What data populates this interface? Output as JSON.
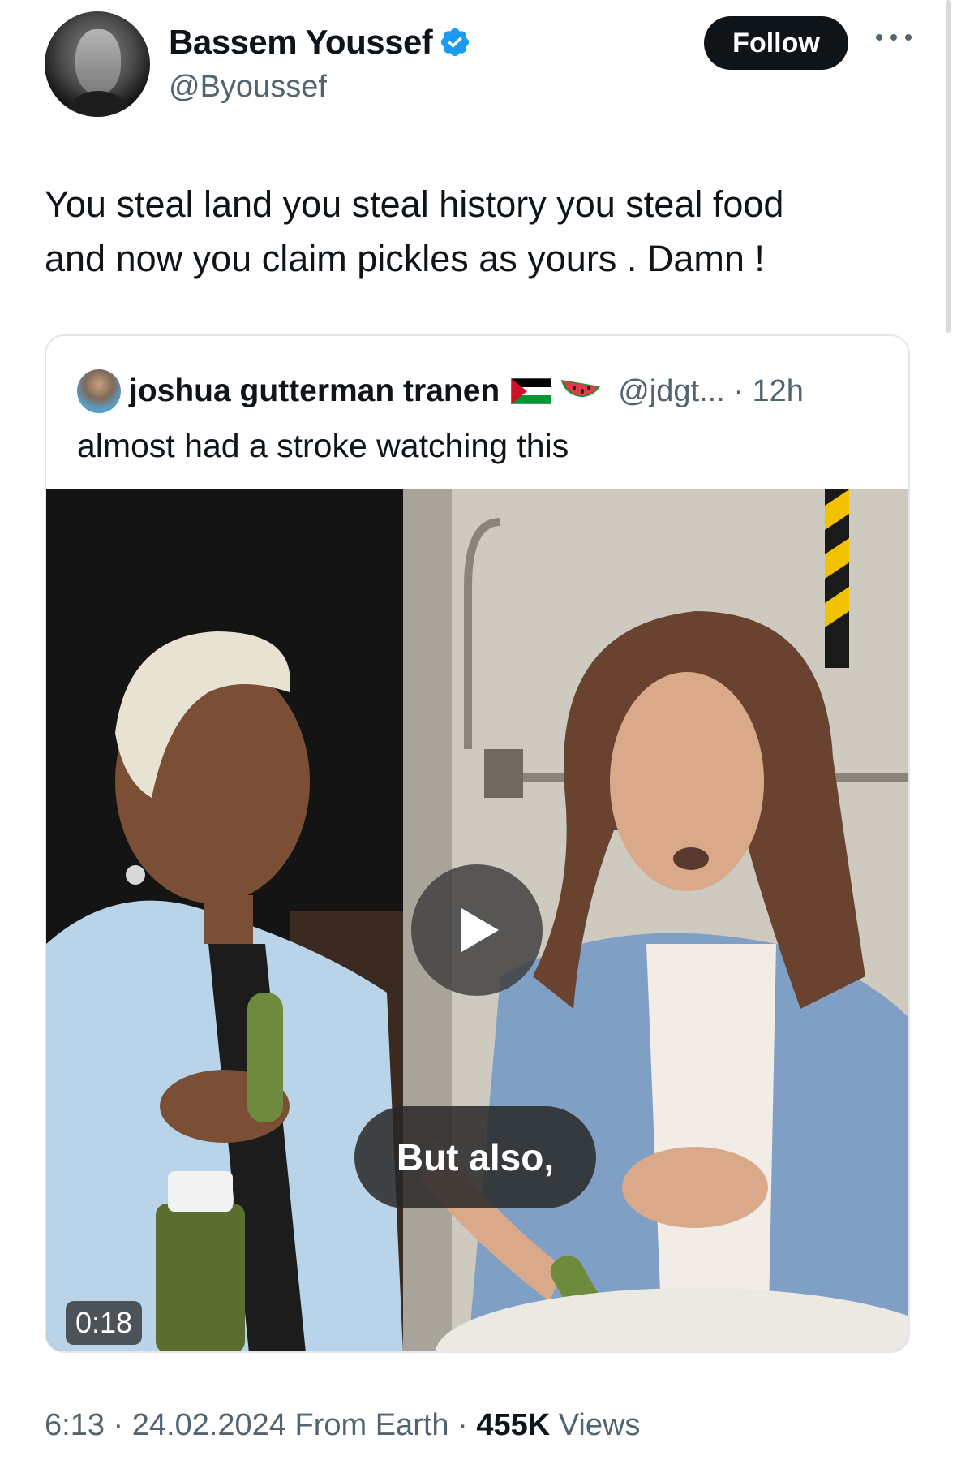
{
  "author": {
    "name": "Bassem Youssef",
    "handle": "@Byoussef",
    "verified": true,
    "follow_label": "Follow"
  },
  "tweet": {
    "text": "You steal land you steal history you steal food\nand now you claim pickles as yours . Damn !"
  },
  "quoted_tweet": {
    "author_name": "joshua gutterman tranen",
    "emojis": [
      "palestine-flag",
      "watermelon"
    ],
    "handle": "@jdgt...",
    "separator": "·",
    "time_ago": "12h",
    "text": "almost had a stroke watching this",
    "video": {
      "caption": "But also,",
      "duration": "0:18"
    }
  },
  "footer": {
    "time": "6:13",
    "date": "24.02.2024",
    "location": "From Earth",
    "views_count": "455K",
    "views_label": "Views"
  },
  "colors": {
    "text_primary": "#0f1419",
    "text_secondary": "#536471",
    "verified_blue": "#1d9bf0",
    "follow_bg": "#0f1419",
    "border": "#e4e7ea"
  }
}
